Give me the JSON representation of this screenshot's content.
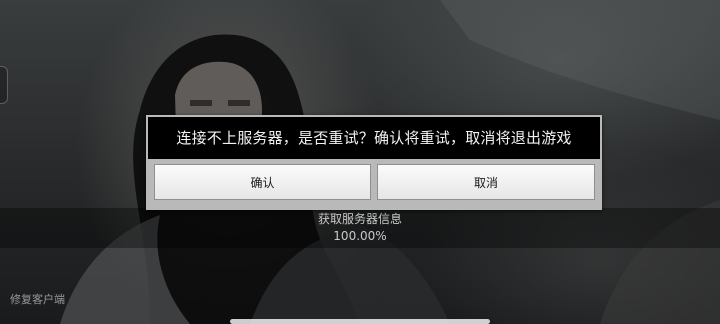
{
  "dialog": {
    "message": "连接不上服务器，是否重试？确认将重试，取消将退出游戏",
    "confirm_label": "确认",
    "cancel_label": "取消"
  },
  "loading": {
    "status_text": "获取服务器信息",
    "progress_text": "100.00%",
    "progress_value": 100.0
  },
  "footer": {
    "repair_label": "修复客户端"
  },
  "colors": {
    "dialog_message_bg": "#000000",
    "dialog_frame": "#b9b9b9",
    "button_bg": "#f0f0f0"
  }
}
